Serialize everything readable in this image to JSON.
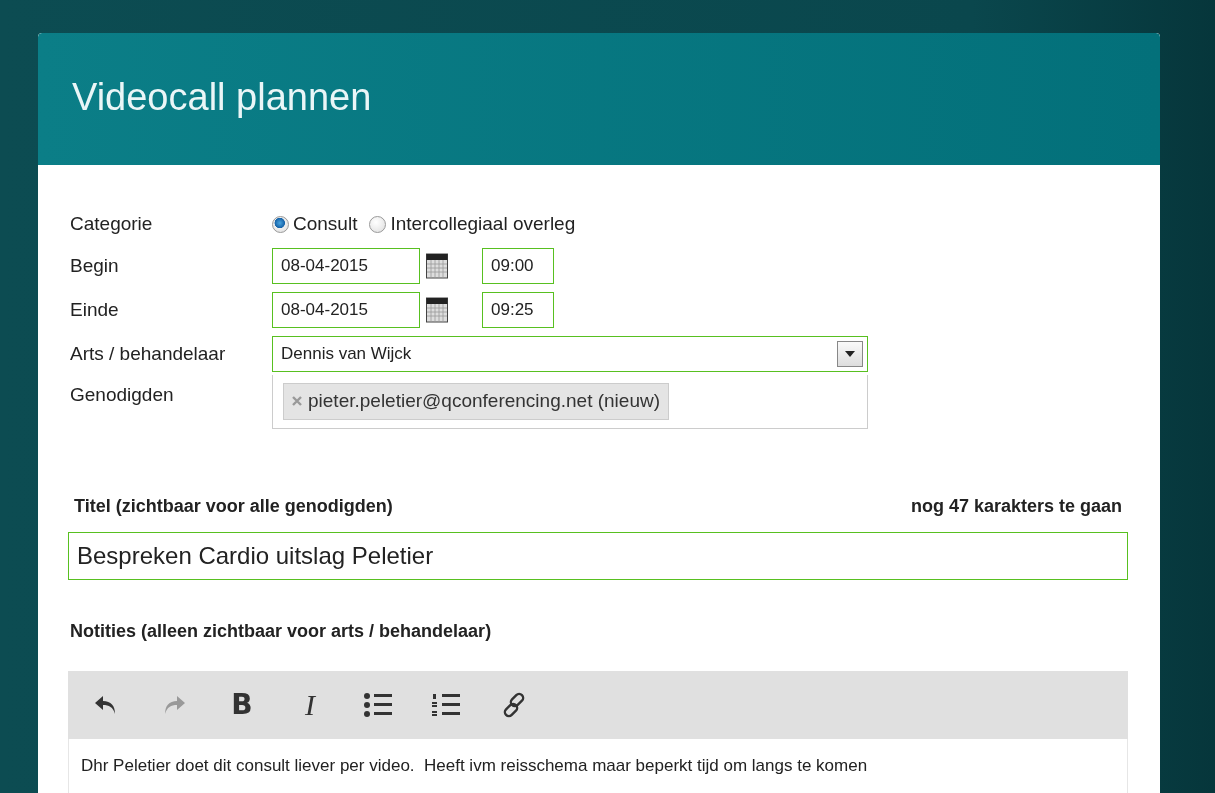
{
  "dialog": {
    "title": "Videocall plannen"
  },
  "form": {
    "category": {
      "label": "Categorie",
      "options": [
        {
          "label": "Consult",
          "selected": true
        },
        {
          "label": "Intercollegiaal overleg",
          "selected": false
        }
      ]
    },
    "begin": {
      "label": "Begin",
      "date": "08-04-2015",
      "time": "09:00"
    },
    "end": {
      "label": "Einde",
      "date": "08-04-2015",
      "time": "09:25"
    },
    "doctor": {
      "label": "Arts / behandelaar",
      "value": "Dennis van Wijck"
    },
    "invitees": {
      "label": "Genodigden",
      "tags": [
        "pieter.peletier@qconferencing.net (nieuw)"
      ]
    },
    "title_field": {
      "label": "Titel (zichtbaar voor alle genodigden)",
      "counter": "nog 47 karakters te gaan",
      "value": "Bespreken Cardio uitslag Peletier"
    },
    "notes": {
      "label": "Notities (alleen zichtbaar voor arts / behandelaar)",
      "toolbar": [
        {
          "kind": "undo",
          "disabled": false
        },
        {
          "kind": "redo",
          "disabled": true
        },
        {
          "kind": "bold",
          "label": "B",
          "disabled": false
        },
        {
          "kind": "italic",
          "label": "I",
          "disabled": false
        },
        {
          "kind": "bullets",
          "disabled": false
        },
        {
          "kind": "numbered",
          "disabled": false
        },
        {
          "kind": "link",
          "disabled": false
        }
      ],
      "text": "Dhr Peletier doet dit consult liever per video.  Heeft ivm reisschema maar beperkt tijd om langs te komen"
    }
  }
}
